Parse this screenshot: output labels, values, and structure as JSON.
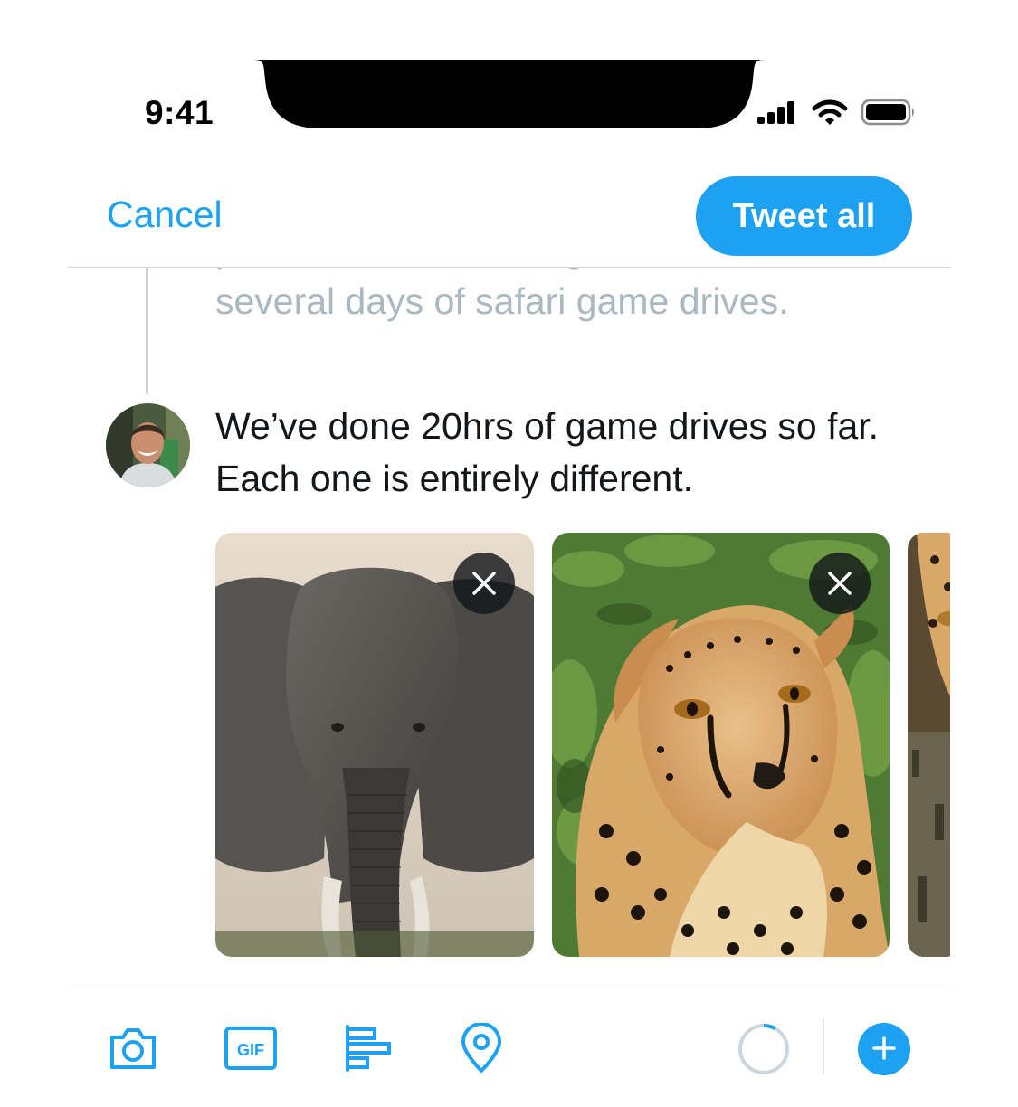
{
  "status_bar": {
    "time": "9:41",
    "icons": [
      "cellular-signal-icon",
      "wifi-icon",
      "battery-icon"
    ]
  },
  "header": {
    "cancel_label": "Cancel",
    "tweet_all_label": "Tweet all"
  },
  "thread": {
    "previous_tweet_lines": [
      "plane to South Serengeti to start",
      "several days of safari game drives."
    ],
    "current_tweet": {
      "text": "We’ve done 20hrs of game drives so far. Each one is entirely different.",
      "media": [
        {
          "subject": "elephant",
          "remove_icon": "close-icon"
        },
        {
          "subject": "cheetah",
          "remove_icon": "close-icon"
        },
        {
          "subject": "leopard"
        }
      ]
    }
  },
  "toolbar": {
    "tools": [
      "camera-icon",
      "gif-icon",
      "poll-icon",
      "location-pin-icon"
    ],
    "character_progress": 0.08,
    "add_icon": "plus-icon"
  },
  "colors": {
    "accent": "#1da1f2",
    "text": "#14171a",
    "muted_text": "#aab8c2",
    "divider": "#d8d8d8",
    "thread_line": "#ccd6dd"
  }
}
